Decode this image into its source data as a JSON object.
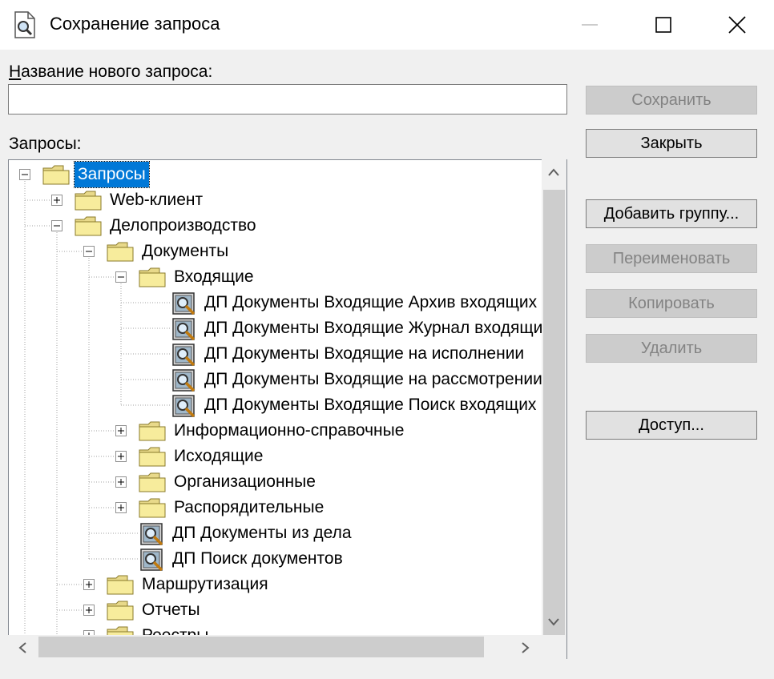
{
  "window": {
    "title": "Сохранение запроса",
    "icon": "query-document-icon",
    "controls": [
      "minimize-icon",
      "maximize-icon",
      "close-icon"
    ]
  },
  "name_field": {
    "label": "Название нового запроса:",
    "accel_char": "Н",
    "label_rest": "азвание нового запроса:",
    "value": "",
    "placeholder": ""
  },
  "tree_label": "Запросы:",
  "buttons": {
    "save": "Сохранить",
    "close": "Закрыть",
    "add_group": "Добавить группу...",
    "rename": "Переименовать",
    "copy": "Копировать",
    "delete": "Удалить",
    "access": "Доступ..."
  },
  "tree": {
    "nodes": [
      {
        "level": 0,
        "type": "folder",
        "expander": "minus",
        "label": "Запросы",
        "selected": true
      },
      {
        "level": 1,
        "type": "folder",
        "expander": "plus",
        "label": "Web-клиент"
      },
      {
        "level": 1,
        "type": "folder",
        "expander": "minus",
        "label": "Делопроизводство"
      },
      {
        "level": 2,
        "type": "folder",
        "expander": "minus",
        "label": "Документы"
      },
      {
        "level": 3,
        "type": "folder",
        "expander": "minus",
        "label": "Входящие"
      },
      {
        "level": 4,
        "type": "query",
        "label": "ДП Документы Входящие Архив входящих"
      },
      {
        "level": 4,
        "type": "query",
        "label": "ДП Документы Входящие Журнал входящих"
      },
      {
        "level": 4,
        "type": "query",
        "label": "ДП Документы Входящие на исполнении"
      },
      {
        "level": 4,
        "type": "query",
        "label": "ДП Документы Входящие на рассмотрении"
      },
      {
        "level": 4,
        "type": "query",
        "label": "ДП Документы Входящие Поиск входящих"
      },
      {
        "level": 3,
        "type": "folder",
        "expander": "plus",
        "label": "Информационно-справочные"
      },
      {
        "level": 3,
        "type": "folder",
        "expander": "plus",
        "label": "Исходящие"
      },
      {
        "level": 3,
        "type": "folder",
        "expander": "plus",
        "label": "Организационные"
      },
      {
        "level": 3,
        "type": "folder",
        "expander": "plus",
        "label": "Распорядительные"
      },
      {
        "level": 3,
        "type": "query",
        "label": "ДП Документы из дела"
      },
      {
        "level": 3,
        "type": "query",
        "label": "ДП Поиск документов"
      },
      {
        "level": 2,
        "type": "folder",
        "expander": "plus",
        "label": "Маршрутизация"
      },
      {
        "level": 2,
        "type": "folder",
        "expander": "plus",
        "label": "Отчеты"
      },
      {
        "level": 2,
        "type": "folder",
        "expander": "plus",
        "label": "Реестры"
      }
    ]
  },
  "scrollbars": {
    "vertical": [
      "scroll-up-icon",
      "scroll-down-icon"
    ],
    "horizontal": [
      "scroll-left-icon",
      "scroll-right-icon"
    ]
  }
}
